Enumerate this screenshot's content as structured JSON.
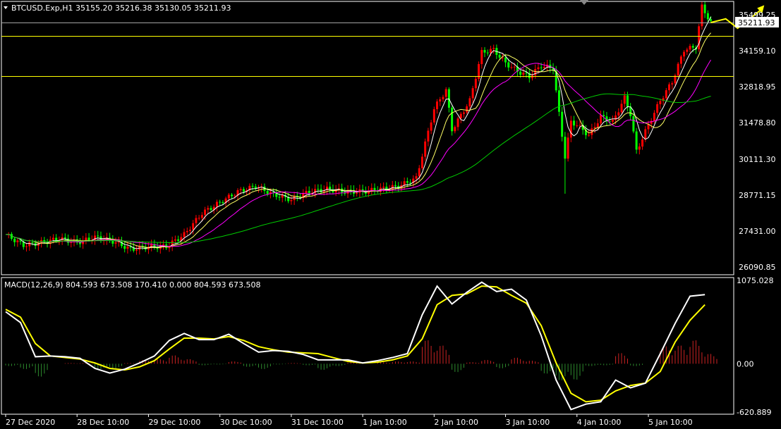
{
  "chart_data": [
    {
      "type": "candlestick",
      "symbol": "BTCUSD.Exp,H1",
      "ohlc_readout": [
        "35155.20",
        "35216.38",
        "35130.05",
        "35211.93"
      ],
      "current_price_label": "35211.93",
      "price_ticks": [
        "35499.25",
        "34159.10",
        "32818.95",
        "31478.80",
        "30111.30",
        "28771.15",
        "27431.00",
        "26090.85"
      ],
      "ylim": [
        25800,
        36000
      ],
      "x_ticks": [
        "27 Dec 2020",
        "28 Dec 10:00",
        "29 Dec 10:00",
        "30 Dec 10:00",
        "31 Dec 10:00",
        "1 Jan 10:00",
        "2 Jan 10:00",
        "3 Jan 10:00",
        "4 Jan 10:00",
        "5 Jan 10:00"
      ],
      "x_tick_index": [
        0,
        24,
        48,
        72,
        96,
        120,
        144,
        168,
        192,
        216
      ],
      "horizontal_levels": [
        35200,
        34700,
        33200
      ],
      "colors": {
        "up": "#ff0000",
        "down": "#00ff00",
        "sma_short": "#ffffff",
        "sma_mid": "#ffff66",
        "sma_long": "#ff00ff",
        "sma_100": "#00cc00",
        "level": "#ffff00",
        "grid_ref": "#aaaaaa",
        "arrow": "#ffff00"
      },
      "close_path": [
        [
          0,
          27300
        ],
        [
          6,
          26900
        ],
        [
          12,
          27000
        ],
        [
          18,
          27150
        ],
        [
          24,
          27000
        ],
        [
          30,
          27200
        ],
        [
          36,
          27050
        ],
        [
          42,
          26750
        ],
        [
          48,
          26850
        ],
        [
          54,
          26850
        ],
        [
          60,
          27300
        ],
        [
          66,
          28100
        ],
        [
          72,
          28500
        ],
        [
          78,
          28900
        ],
        [
          84,
          29100
        ],
        [
          90,
          28800
        ],
        [
          96,
          28600
        ],
        [
          102,
          28900
        ],
        [
          108,
          29000
        ],
        [
          114,
          28900
        ],
        [
          120,
          28900
        ],
        [
          126,
          29000
        ],
        [
          132,
          29100
        ],
        [
          138,
          29400
        ],
        [
          144,
          32000
        ],
        [
          148,
          32700
        ],
        [
          150,
          31200
        ],
        [
          156,
          32300
        ],
        [
          160,
          34100
        ],
        [
          164,
          34200
        ],
        [
          168,
          33700
        ],
        [
          172,
          33400
        ],
        [
          176,
          33200
        ],
        [
          180,
          33600
        ],
        [
          184,
          33500
        ],
        [
          186,
          31800
        ],
        [
          188,
          30200
        ],
        [
          190,
          31500
        ],
        [
          192,
          31400
        ],
        [
          196,
          31000
        ],
        [
          200,
          31700
        ],
        [
          204,
          31500
        ],
        [
          208,
          32400
        ],
        [
          210,
          31800
        ],
        [
          212,
          30400
        ],
        [
          216,
          31400
        ],
        [
          220,
          32300
        ],
        [
          224,
          33000
        ],
        [
          228,
          34200
        ],
        [
          232,
          34300
        ],
        [
          234,
          35800
        ],
        [
          237,
          35211
        ]
      ],
      "forecast_arrow": [
        [
          237,
          35211
        ],
        [
          242,
          35350
        ],
        [
          246,
          35000
        ],
        [
          254,
          35700
        ]
      ]
    },
    {
      "type": "line",
      "title": "MACD(12,26,9)",
      "readout": [
        "804.593",
        "673.508",
        "170.410",
        "0.000",
        "804.593",
        "673.508"
      ],
      "y_ticks": [
        "1075.028",
        "0.00",
        "-620.889"
      ],
      "ylim": [
        -650,
        1110
      ],
      "series": [
        {
          "name": "MACD",
          "color": "#ffffff",
          "x": [
            0,
            5,
            10,
            15,
            20,
            25,
            30,
            35,
            40,
            45,
            50,
            55,
            60,
            65,
            70,
            75,
            80,
            85,
            90,
            95,
            100,
            105,
            110,
            115,
            120,
            125,
            130,
            135,
            140,
            145,
            150,
            155,
            160,
            165,
            170,
            175,
            180,
            185,
            190,
            195,
            200,
            205,
            210,
            215,
            220,
            225,
            230,
            235
          ],
          "values": [
            670,
            530,
            90,
            100,
            90,
            70,
            -60,
            -120,
            -70,
            10,
            100,
            300,
            390,
            310,
            310,
            380,
            260,
            150,
            170,
            160,
            120,
            50,
            50,
            50,
            10,
            40,
            80,
            130,
            630,
            1000,
            770,
            920,
            1050,
            930,
            960,
            820,
            360,
            -210,
            -590,
            -520,
            -490,
            -210,
            -310,
            -250,
            130,
            520,
            870,
            890
          ]
        },
        {
          "name": "Signal",
          "color": "#ffff00",
          "x": [
            0,
            5,
            10,
            15,
            20,
            25,
            30,
            35,
            40,
            45,
            50,
            55,
            60,
            65,
            70,
            75,
            80,
            85,
            90,
            95,
            100,
            105,
            110,
            115,
            120,
            125,
            130,
            135,
            140,
            145,
            150,
            155,
            160,
            165,
            170,
            175,
            180,
            185,
            190,
            195,
            200,
            205,
            210,
            215,
            220,
            225,
            230,
            235
          ],
          "values": [
            700,
            600,
            260,
            100,
            80,
            60,
            10,
            -60,
            -80,
            -40,
            40,
            190,
            330,
            330,
            320,
            350,
            300,
            220,
            180,
            150,
            140,
            130,
            80,
            30,
            10,
            20,
            50,
            100,
            320,
            760,
            880,
            900,
            1000,
            990,
            880,
            780,
            490,
            10,
            -380,
            -490,
            -470,
            -350,
            -280,
            -250,
            -100,
            280,
            560,
            760
          ]
        },
        {
          "name": "Histogram",
          "color": "#ff0000",
          "x": [
            0,
            5,
            10,
            15,
            20,
            25,
            30,
            35,
            40,
            45,
            50,
            55,
            60,
            65,
            70,
            75,
            80,
            85,
            90,
            95,
            100,
            105,
            110,
            115,
            120,
            125,
            130,
            135,
            140,
            145,
            150,
            155,
            160,
            165,
            170,
            175,
            180,
            185,
            190,
            195,
            200,
            205,
            210,
            215,
            220,
            225,
            230,
            235
          ],
          "values": [
            -30,
            -70,
            -170,
            0,
            10,
            10,
            -70,
            -60,
            10,
            50,
            60,
            110,
            60,
            -20,
            -10,
            30,
            -40,
            -70,
            -10,
            10,
            -20,
            -80,
            -30,
            20,
            0,
            20,
            30,
            30,
            310,
            240,
            -110,
            20,
            50,
            -60,
            80,
            40,
            -130,
            -220,
            -210,
            -30,
            -20,
            140,
            -30,
            0,
            230,
            240,
            310,
            130
          ]
        }
      ]
    }
  ]
}
